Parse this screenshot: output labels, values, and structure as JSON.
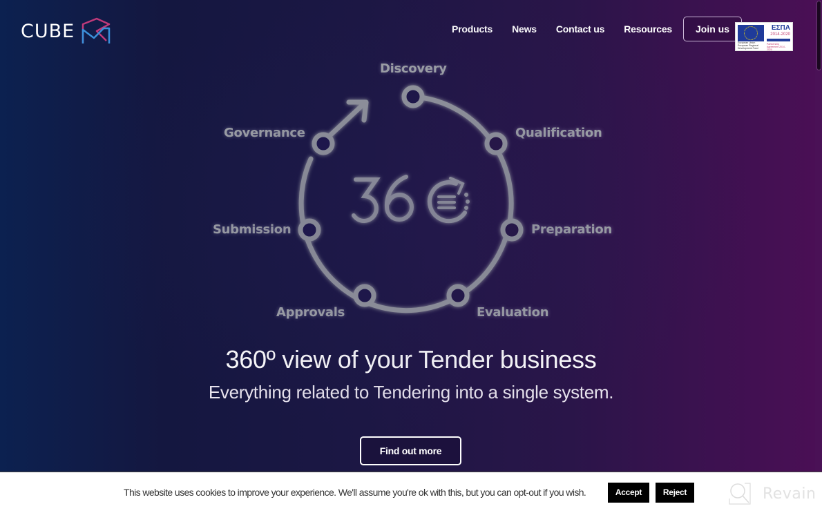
{
  "header": {
    "logo_text": "CUBE",
    "logo_icon": "cube-rm-icon",
    "nav": [
      {
        "label": "Products"
      },
      {
        "label": "News"
      },
      {
        "label": "Contact us"
      },
      {
        "label": "Resources"
      }
    ],
    "join_label": "Join us",
    "espa_badge": {
      "title": "ΕΣΠΑ",
      "years": "2014-2020",
      "left_caption": "European Union European Regional Development Fund",
      "right_caption": "Partnership Agreement 2014 - 2020"
    }
  },
  "diagram": {
    "center_label": "360",
    "stages": [
      {
        "label": "Discovery"
      },
      {
        "label": "Qualification"
      },
      {
        "label": "Preparation"
      },
      {
        "label": "Evaluation"
      },
      {
        "label": "Approvals"
      },
      {
        "label": "Submission"
      },
      {
        "label": "Governance"
      }
    ],
    "stroke_color": "#9a9ea2"
  },
  "hero": {
    "headline": "360º view of your Tender business",
    "subline": "Everything related to Tendering into a single system.",
    "cta_label": "Find out more"
  },
  "cookie_banner": {
    "text": "This website uses cookies to improve your experience. We'll assume you're ok with this, but you can opt-out if you wish.",
    "accept_label": "Accept",
    "reject_label": "Reject"
  },
  "watermark": {
    "label": "Revain"
  },
  "colors": {
    "logo_pink": "#c03a7a",
    "logo_blue": "#3b8fd9",
    "bg_left": "#0c2150",
    "bg_right": "#4a0f55"
  }
}
